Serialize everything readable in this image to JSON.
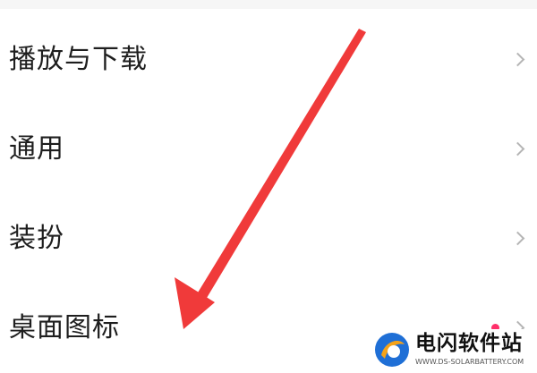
{
  "settings": {
    "items": [
      {
        "label": "播放与下载",
        "has_chevron": true,
        "has_badge": false
      },
      {
        "label": "通用",
        "has_chevron": true,
        "has_badge": false
      },
      {
        "label": "装扮",
        "has_chevron": true,
        "has_badge": false
      },
      {
        "label": "桌面图标",
        "has_chevron": true,
        "has_badge": true
      }
    ]
  },
  "annotation": {
    "type": "arrow",
    "points_to": "桌面图标",
    "color": "#f03a3a"
  },
  "watermark": {
    "title": "电闪软件站",
    "url": "WWW.DS-SOLARBATTERY.COM",
    "logo_colors": [
      "#1f6fd6",
      "#f5a31a"
    ]
  },
  "colors": {
    "badge": "#ff2f6a",
    "chevron": "#b5b5b5",
    "text": "#1e1e1e"
  }
}
